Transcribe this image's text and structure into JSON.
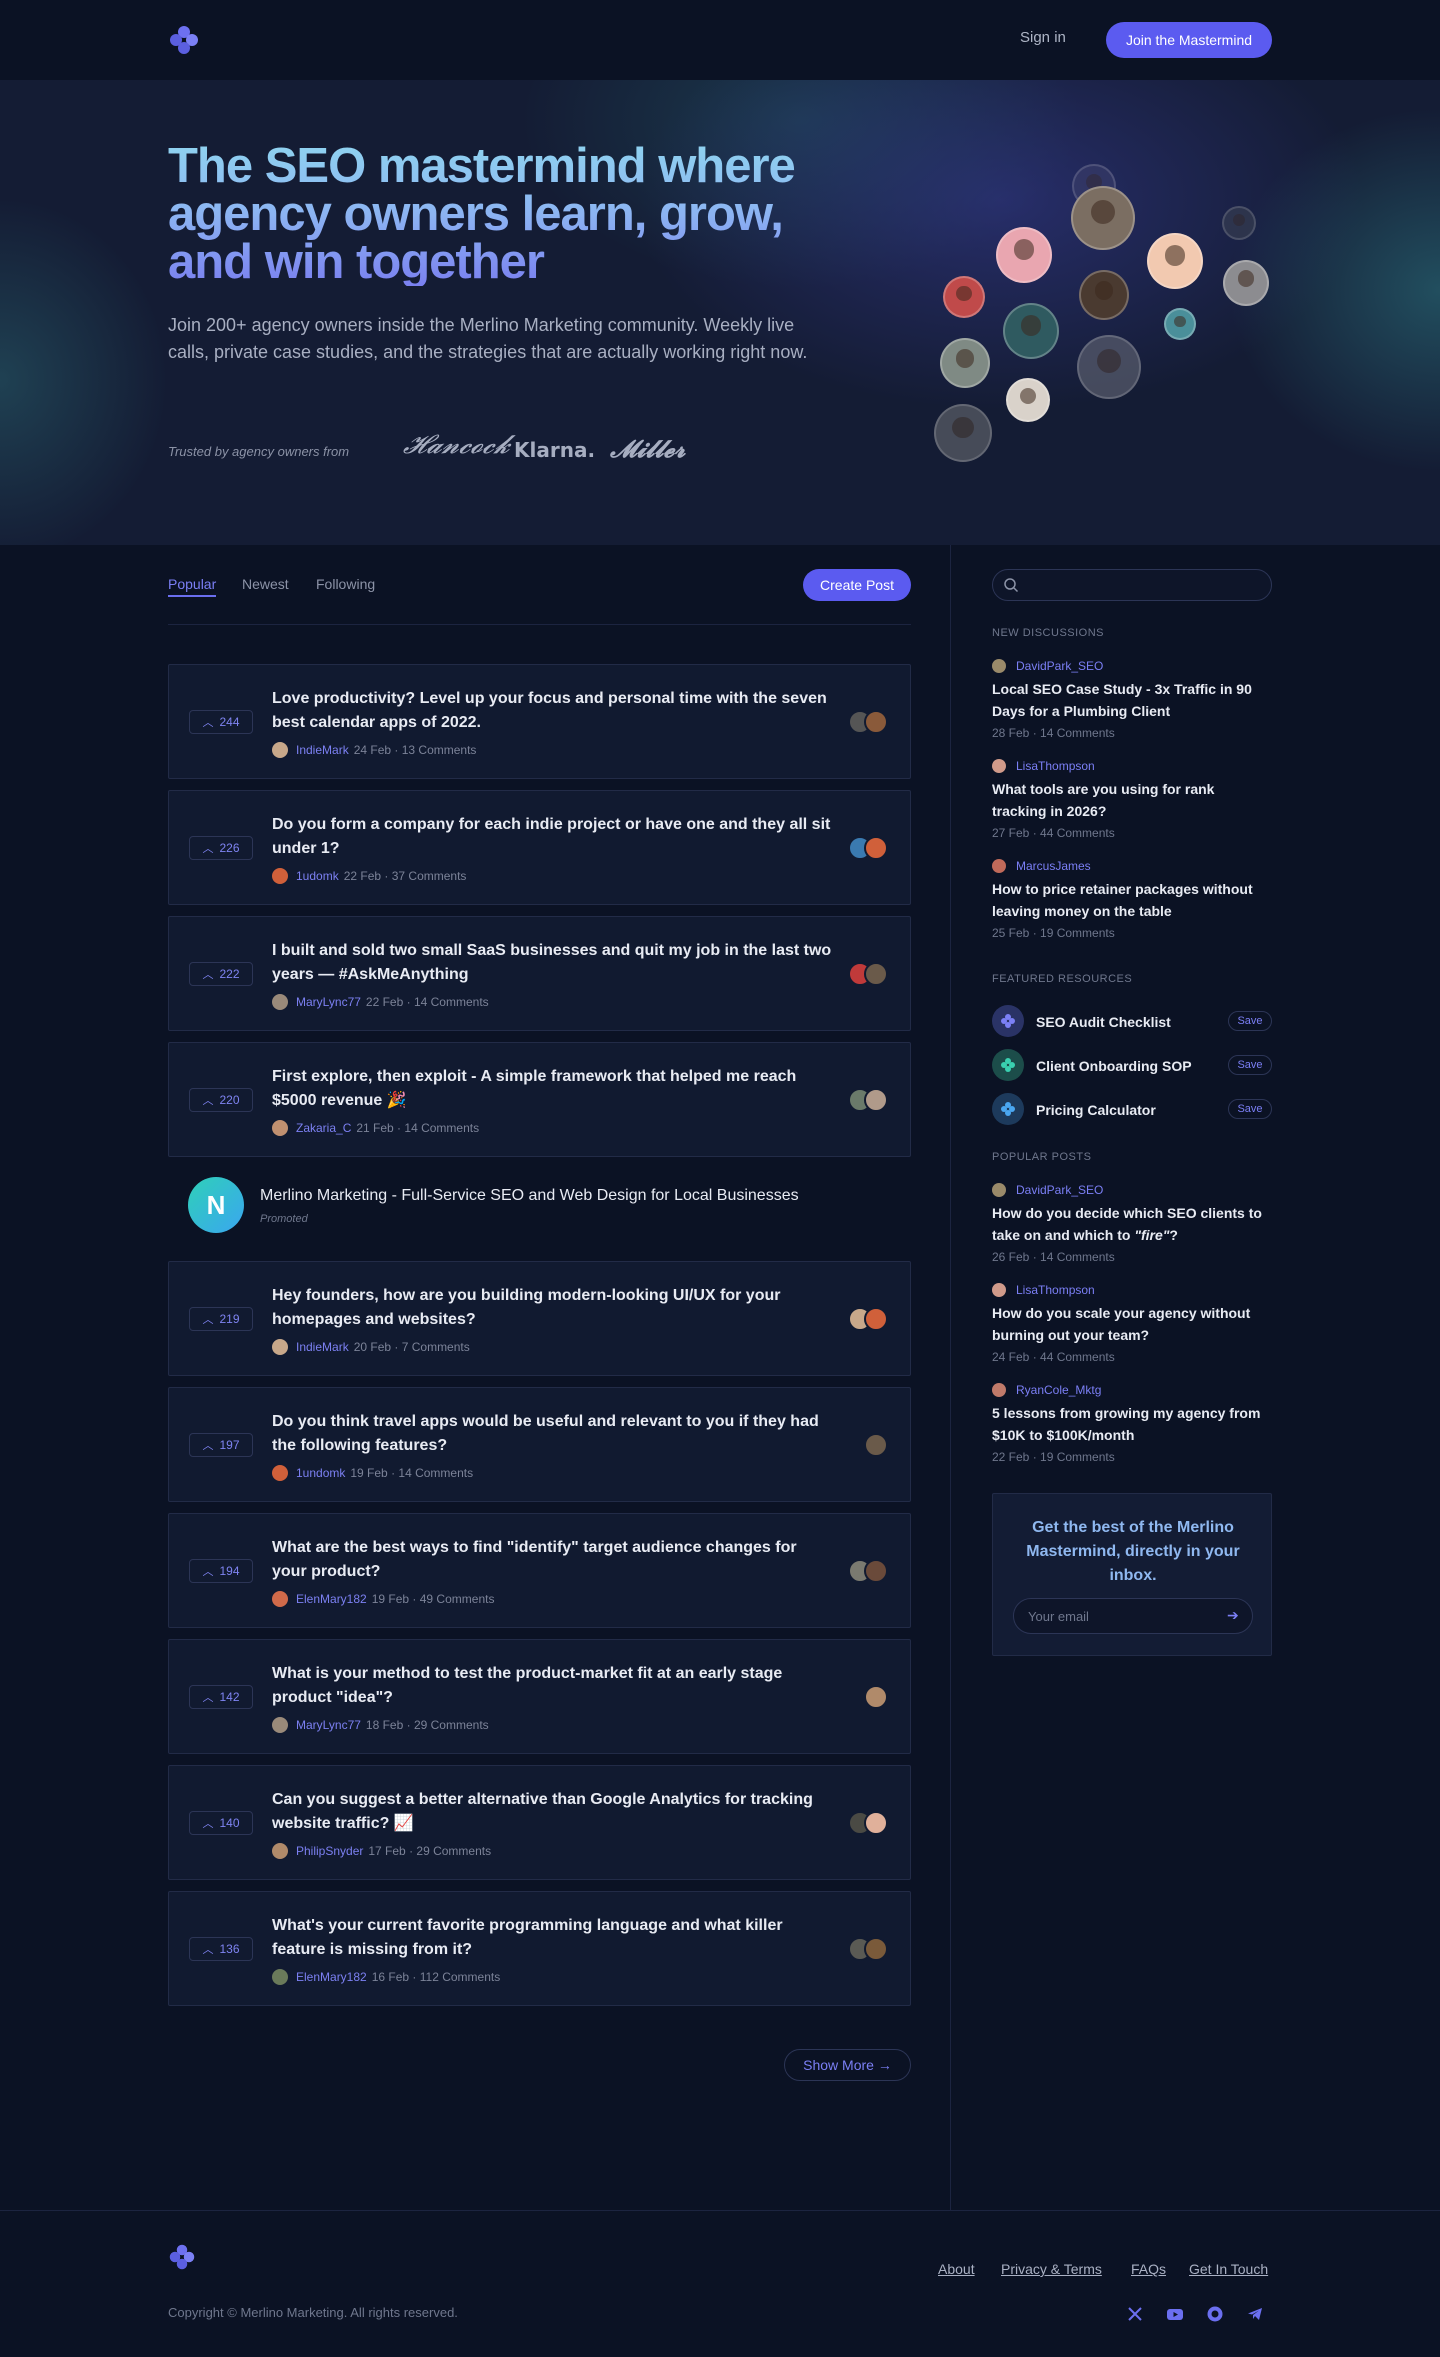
{
  "header": {
    "signin_label": "Sign in",
    "join_label": "Join the Mastermind"
  },
  "hero": {
    "title": "The SEO mastermind where agency owners learn, grow, and win together",
    "subtitle": "Join 200+ agency owners inside the Merlino Marketing community. Weekly live calls, private case studies, and the strategies that are actually working right now.",
    "trusted_label": "Trusted by agency owners from",
    "brands": [
      "Klarna."
    ]
  },
  "feed": {
    "tabs": [
      "Popular",
      "Newest",
      "Following"
    ],
    "create_label": "Create Post",
    "posts": [
      {
        "votes": "244",
        "title": "Love productivity? Level up your focus and personal time with the seven best calendar apps of 2022.",
        "author": "IndieMark",
        "date": "24 Feb",
        "comments": "13 Comments"
      },
      {
        "votes": "226",
        "title": "Do you form a company for each indie project or have one and they all sit under 1?",
        "author": "1udomk",
        "date": "22 Feb",
        "comments": "37 Comments"
      },
      {
        "votes": "222",
        "title": "I built and sold two small SaaS businesses and quit my job in the last two years — #AskMeAnything",
        "author": "MaryLync77",
        "date": "22 Feb",
        "comments": "14 Comments"
      },
      {
        "votes": "220",
        "title": "First explore, then exploit - A simple framework that helped me reach $5000 revenue 🎉",
        "author": "Zakaria_C",
        "date": "21 Feb",
        "comments": "14 Comments"
      },
      {
        "votes": "219",
        "title": "Hey founders, how are you building modern-looking UI/UX for your homepages and websites?",
        "author": "IndieMark",
        "date": "20 Feb",
        "comments": "7 Comments"
      },
      {
        "votes": "197",
        "title": "Do you think travel apps would be useful and relevant to you if they had the following features?",
        "author": "1undomk",
        "date": "19 Feb",
        "comments": "14 Comments"
      },
      {
        "votes": "194",
        "title": "What are the best ways to find \"identify\" target audience changes for your product?",
        "author": "ElenMary182",
        "date": "19 Feb",
        "comments": "49 Comments"
      },
      {
        "votes": "142",
        "title": "What is your method to test the product-market fit at an early stage product \"idea\"?",
        "author": "MaryLync77",
        "date": "18 Feb",
        "comments": "29 Comments"
      },
      {
        "votes": "140",
        "title": "Can you suggest a better alternative than Google Analytics for tracking website traffic? 📈",
        "author": "PhilipSnyder",
        "date": "17 Feb",
        "comments": "29 Comments"
      },
      {
        "votes": "136",
        "title": "What's your current favorite programming language and what killer feature is missing from it?",
        "author": "ElenMary182",
        "date": "16 Feb",
        "comments": "112 Comments"
      }
    ],
    "promo": {
      "logo_letter": "N",
      "title": "Merlino Marketing - Full-Service SEO and Web Design for Local Businesses",
      "tag": "Promoted"
    },
    "show_more_label": "Show More →"
  },
  "sidebar": {
    "new_discussions_heading": "NEW DISCUSSIONS",
    "new_discussions": [
      {
        "author": "DavidPark_SEO",
        "title": "Local SEO Case Study - 3x Traffic in 90 Days for a Plumbing Client",
        "meta": "28 Feb · 14 Comments"
      },
      {
        "author": "LisaThompson",
        "title": "What tools are you using for rank tracking in 2026?",
        "meta": "27 Feb · 44 Comments"
      },
      {
        "author": "MarcusJames",
        "title": "How to price retainer packages without leaving money on the table",
        "meta": "25 Feb · 19 Comments"
      }
    ],
    "resources_heading": "FEATURED RESOURCES",
    "resources": [
      {
        "label": "SEO Audit Checklist",
        "save": "Save",
        "color": "#2a3366"
      },
      {
        "label": "Client Onboarding SOP",
        "save": "Save",
        "color": "#1c4d4a"
      },
      {
        "label": "Pricing Calculator",
        "save": "Save",
        "color": "#1d3a5c"
      }
    ],
    "popular_heading": "POPULAR POSTS",
    "popular": [
      {
        "author": "DavidPark_SEO",
        "title_prefix": "How do you decide which SEO clients to take on and which to ",
        "title_em": "\"fire\"",
        "title_suffix": "?",
        "meta": "26 Feb · 14 Comments"
      },
      {
        "author": "LisaThompson",
        "title": "How do you scale your agency without burning out your team?",
        "meta": "24 Feb · 44 Comments"
      },
      {
        "author": "RyanCole_Mktg",
        "title": "5 lessons from growing my agency from $10K to $100K/month",
        "meta": "22 Feb · 19 Comments"
      }
    ],
    "newsletter": {
      "title": "Get the best of the Merlino Mastermind, directly in your inbox.",
      "placeholder": "Your email"
    }
  },
  "footer": {
    "links": [
      "About",
      "Privacy & Terms",
      "FAQs",
      "Get In Touch"
    ],
    "copyright": "Copyright © Merlino Marketing. All rights reserved."
  },
  "colors": {
    "accent": "#5b5bf0",
    "background": "#0b1224",
    "card": "#111a30",
    "link": "#7b7ff5"
  }
}
